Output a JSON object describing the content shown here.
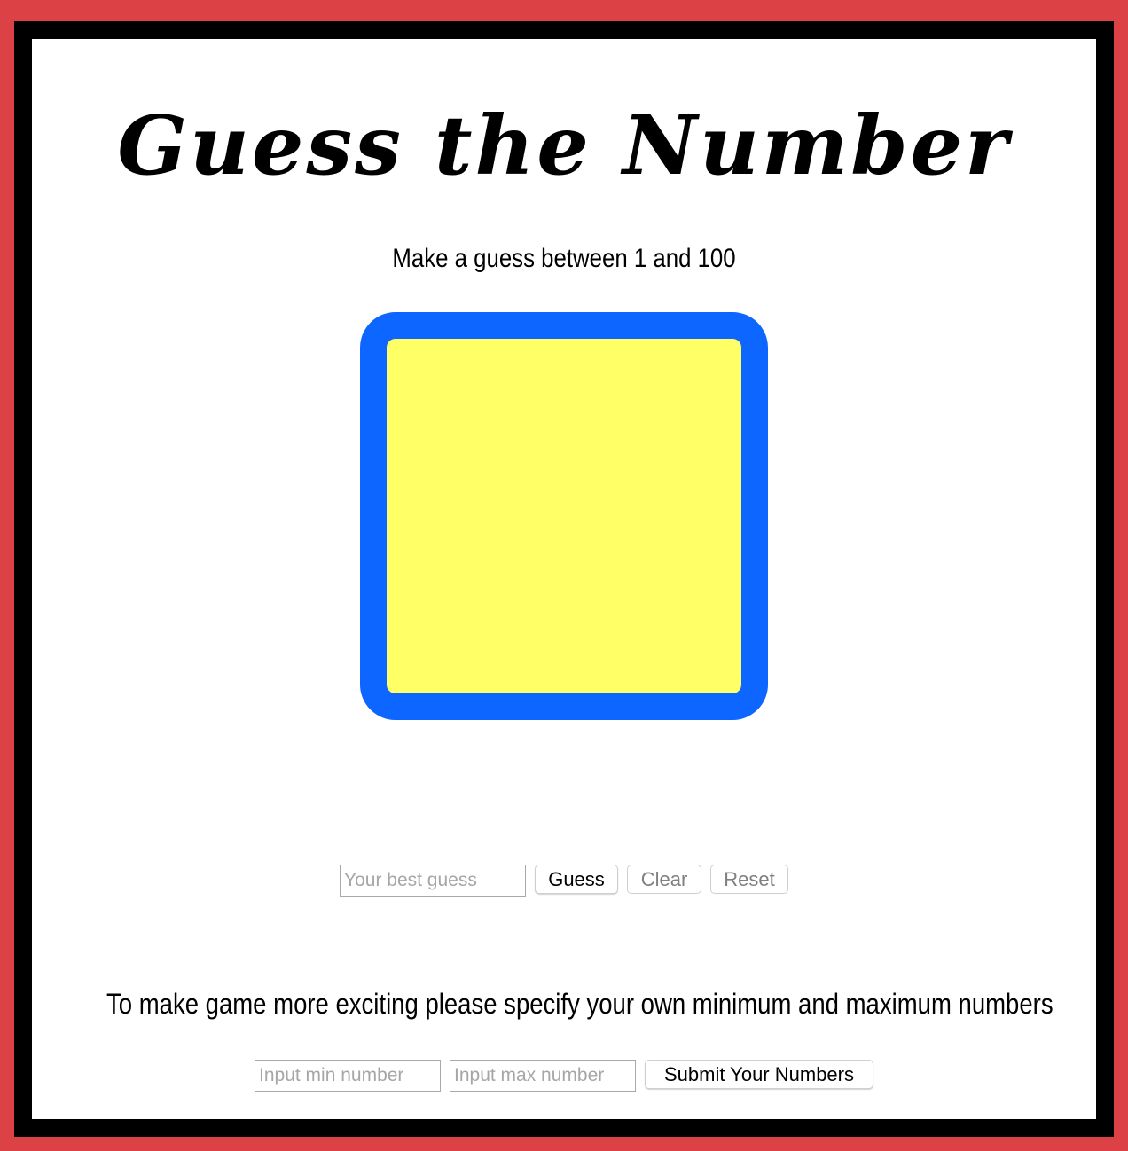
{
  "page": {
    "title": "Guess the Number",
    "instruction": "Make a guess between 1 and 100"
  },
  "display": {
    "border_color": "#0d66ff",
    "fill_color": "#ffff66"
  },
  "guess_form": {
    "input_placeholder": "Your best guess",
    "input_value": "",
    "guess_label": "Guess",
    "clear_label": "Clear",
    "reset_label": "Reset"
  },
  "range_form": {
    "prompt": "To make game more exciting please specify your own minimum and maximum numbers",
    "min_placeholder": "Input min number",
    "max_placeholder": "Input max number",
    "submit_label": "Submit Your Numbers"
  },
  "colors": {
    "outer_border": "#dc4245",
    "frame": "#000000",
    "background": "#ffffff"
  }
}
